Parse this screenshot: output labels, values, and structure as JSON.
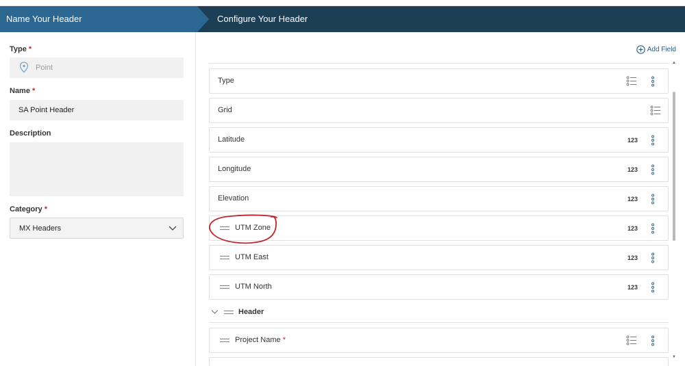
{
  "steps": {
    "step1_label": "Name Your Header",
    "step2_label": "Configure Your Header"
  },
  "form": {
    "type_label": "Type",
    "type_value": "Point",
    "name_label": "Name",
    "name_value": "SA Point Header",
    "description_label": "Description",
    "description_value": "",
    "category_label": "Category",
    "category_value": "MX Headers",
    "required_mark": "*"
  },
  "fields": {
    "add_field_label": "Add Field",
    "rows": [
      {
        "label": "Type",
        "badge": "",
        "icon": "list-icon"
      },
      {
        "label": "Grid",
        "badge": "",
        "icon": "list-icon"
      },
      {
        "label": "Latitude",
        "badge": "123",
        "icon": "numeric"
      },
      {
        "label": "Longitude",
        "badge": "123",
        "icon": "numeric"
      },
      {
        "label": "Elevation",
        "badge": "123",
        "icon": "numeric"
      },
      {
        "label": "UTM Zone",
        "badge": "123",
        "icon": "numeric"
      },
      {
        "label": "UTM East",
        "badge": "123",
        "icon": "numeric"
      },
      {
        "label": "UTM North",
        "badge": "123",
        "icon": "numeric"
      }
    ],
    "group_label": "Header",
    "group_rows": [
      {
        "label": "Project Name",
        "required": "*",
        "icon": "list-icon"
      }
    ]
  },
  "colors": {
    "header_bg": "#1d3f56",
    "active_step_bg": "#2b6790",
    "accent": "#2a5d86",
    "required": "#c0272d",
    "annotation": "#c0272d"
  }
}
